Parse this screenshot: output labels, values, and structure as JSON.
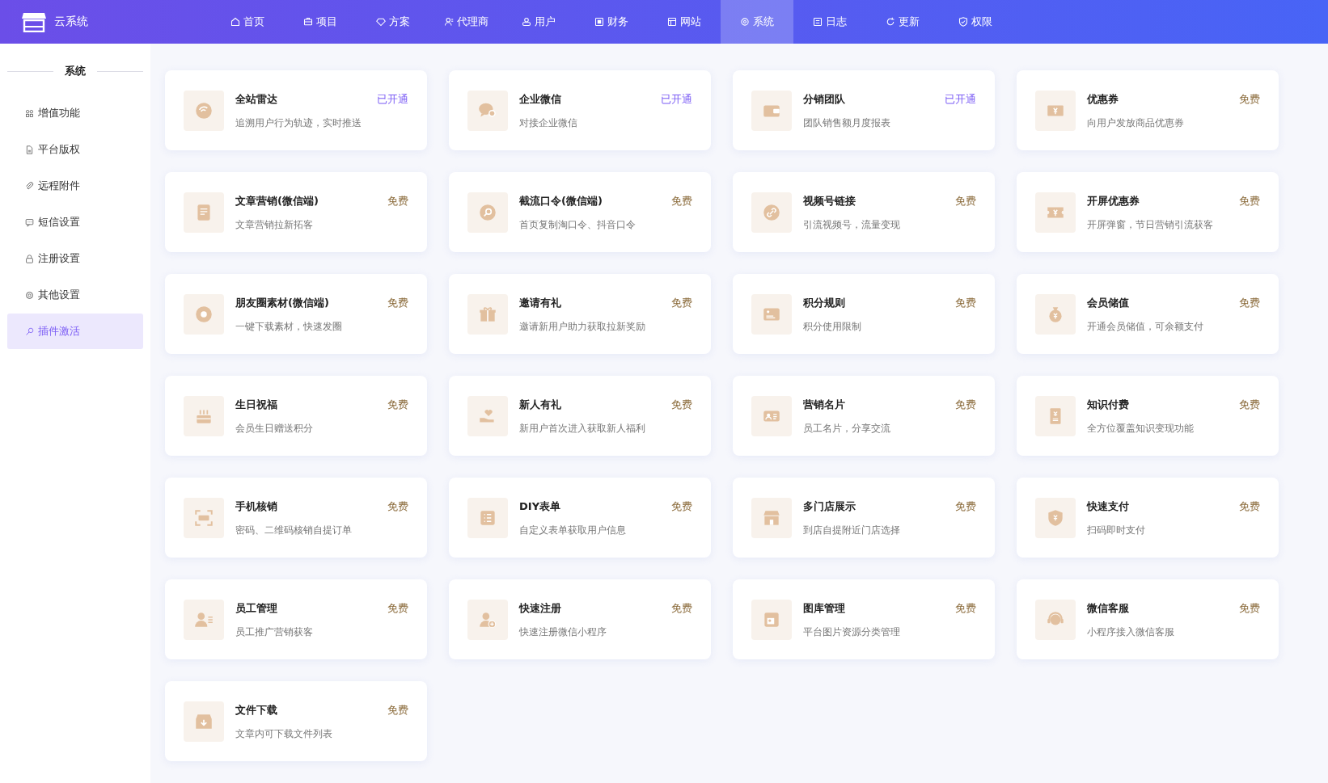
{
  "header": {
    "brand": "云系统",
    "nav": [
      {
        "label": "首页",
        "selected": false
      },
      {
        "label": "项目",
        "selected": false
      },
      {
        "label": "方案",
        "selected": false
      },
      {
        "label": "代理商",
        "selected": false
      },
      {
        "label": "用户",
        "selected": false
      },
      {
        "label": "财务",
        "selected": false
      },
      {
        "label": "网站",
        "selected": false
      },
      {
        "label": "系统",
        "selected": true
      },
      {
        "label": "日志",
        "selected": false
      },
      {
        "label": "更新",
        "selected": false
      },
      {
        "label": "权限",
        "selected": false
      }
    ]
  },
  "sidebar": {
    "title": "系统",
    "items": [
      {
        "label": "增值功能",
        "selected": false
      },
      {
        "label": "平台版权",
        "selected": false
      },
      {
        "label": "远程附件",
        "selected": false
      },
      {
        "label": "短信设置",
        "selected": false
      },
      {
        "label": "注册设置",
        "selected": false
      },
      {
        "label": "其他设置",
        "selected": false
      },
      {
        "label": "插件激活",
        "selected": true
      }
    ]
  },
  "plugins": [
    {
      "name": "全站雷达",
      "desc": "追溯用户行为轨迹，实时推送",
      "status": "已开通",
      "activated": true
    },
    {
      "name": "企业微信",
      "desc": "对接企业微信",
      "status": "已开通",
      "activated": true
    },
    {
      "name": "分销团队",
      "desc": "团队销售额月度报表",
      "status": "已开通",
      "activated": true
    },
    {
      "name": "优惠券",
      "desc": "向用户发放商品优惠券",
      "status": "免费",
      "activated": false
    },
    {
      "name": "文章营销(微信端)",
      "desc": "文章营销拉新拓客",
      "status": "免费",
      "activated": false
    },
    {
      "name": "截流口令(微信端)",
      "desc": "首页复制淘口令、抖音口令",
      "status": "免费",
      "activated": false
    },
    {
      "name": "视频号链接",
      "desc": "引流视频号，流量变现",
      "status": "免费",
      "activated": false
    },
    {
      "name": "开屏优惠券",
      "desc": "开屏弹窗，节日营销引流获客",
      "status": "免费",
      "activated": false
    },
    {
      "name": "朋友圈素材(微信端)",
      "desc": "一键下载素材，快速发圈",
      "status": "免费",
      "activated": false
    },
    {
      "name": "邀请有礼",
      "desc": "邀请新用户助力获取拉新奖励",
      "status": "免费",
      "activated": false
    },
    {
      "name": "积分规则",
      "desc": "积分使用限制",
      "status": "免费",
      "activated": false
    },
    {
      "name": "会员储值",
      "desc": "开通会员储值，可余额支付",
      "status": "免费",
      "activated": false
    },
    {
      "name": "生日祝福",
      "desc": "会员生日赠送积分",
      "status": "免费",
      "activated": false
    },
    {
      "name": "新人有礼",
      "desc": "新用户首次进入获取新人福利",
      "status": "免费",
      "activated": false
    },
    {
      "name": "营销名片",
      "desc": "员工名片，分享交流",
      "status": "免费",
      "activated": false
    },
    {
      "name": "知识付费",
      "desc": "全方位覆盖知识变现功能",
      "status": "免费",
      "activated": false
    },
    {
      "name": "手机核销",
      "desc": "密码、二维码核销自提订单",
      "status": "免费",
      "activated": false
    },
    {
      "name": "DIY表单",
      "desc": "自定义表单获取用户信息",
      "status": "免费",
      "activated": false
    },
    {
      "name": "多门店展示",
      "desc": "到店自提附近门店选择",
      "status": "免费",
      "activated": false
    },
    {
      "name": "快速支付",
      "desc": "扫码即时支付",
      "status": "免费",
      "activated": false
    },
    {
      "name": "员工管理",
      "desc": "员工推广营销获客",
      "status": "免费",
      "activated": false
    },
    {
      "name": "快速注册",
      "desc": "快速注册微信小程序",
      "status": "免费",
      "activated": false
    },
    {
      "name": "图库管理",
      "desc": "平台图片资源分类管理",
      "status": "免费",
      "activated": false
    },
    {
      "name": "微信客服",
      "desc": "小程序接入微信客服",
      "status": "免费",
      "activated": false
    },
    {
      "name": "文件下载",
      "desc": "文章内可下载文件列表",
      "status": "免费",
      "activated": false
    }
  ]
}
